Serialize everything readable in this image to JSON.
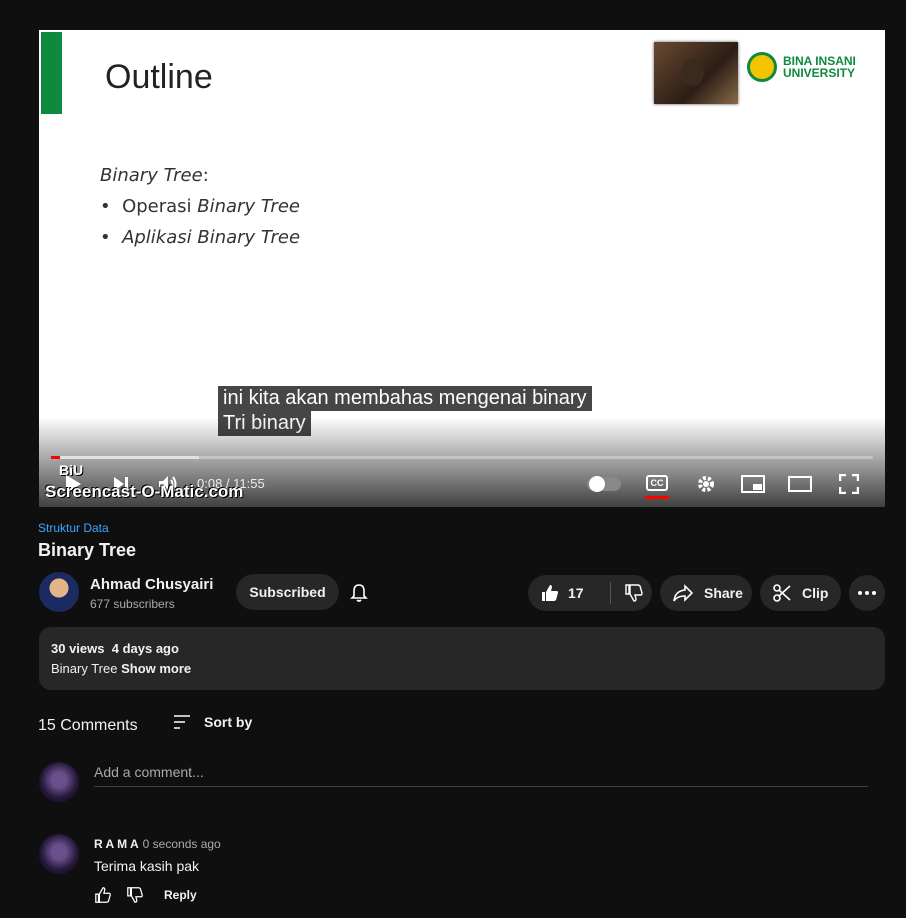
{
  "slide": {
    "title": "Outline",
    "heading": "Binary Tree",
    "heading_suffix": ":",
    "bullets": [
      {
        "prefix": "Operasi ",
        "em": "Binary Tree"
      },
      {
        "prefix": "",
        "em": "Aplikasi Binary Tree"
      }
    ],
    "logo_line1": "BINA INSANI",
    "logo_line2": "UNIVERSITY"
  },
  "captions": {
    "line1": "ini kita akan membahas mengenai binary",
    "line2": "Tri binary"
  },
  "player": {
    "time": "0:08 / 11:55",
    "watermark": "Screencast-O-Matic.com",
    "biu": "BiU",
    "progress_fraction": 0.011,
    "buffered_fraction": 0.18,
    "cc_label": "CC"
  },
  "video": {
    "category": "Struktur Data",
    "title": "Binary Tree"
  },
  "channel": {
    "name": "Ahmad Chusyairi",
    "subscribers": "677 subscribers",
    "subscribed_label": "Subscribed"
  },
  "actions": {
    "likes": "17",
    "share": "Share",
    "clip": "Clip"
  },
  "description": {
    "views": "30 views",
    "age": "4 days ago",
    "text": "Binary Tree ",
    "show_more": "Show more"
  },
  "comments": {
    "count": "15 Comments",
    "sort_label": "Sort by",
    "add_placeholder": "Add a comment...",
    "items": [
      {
        "author": "R A M A",
        "time": "0 seconds ago",
        "text": "Terima kasih pak",
        "reply": "Reply"
      }
    ]
  },
  "colors": {
    "accent": "#3ea6ff",
    "progress": "#ff0000",
    "slide_green": "#0e8a3e"
  }
}
